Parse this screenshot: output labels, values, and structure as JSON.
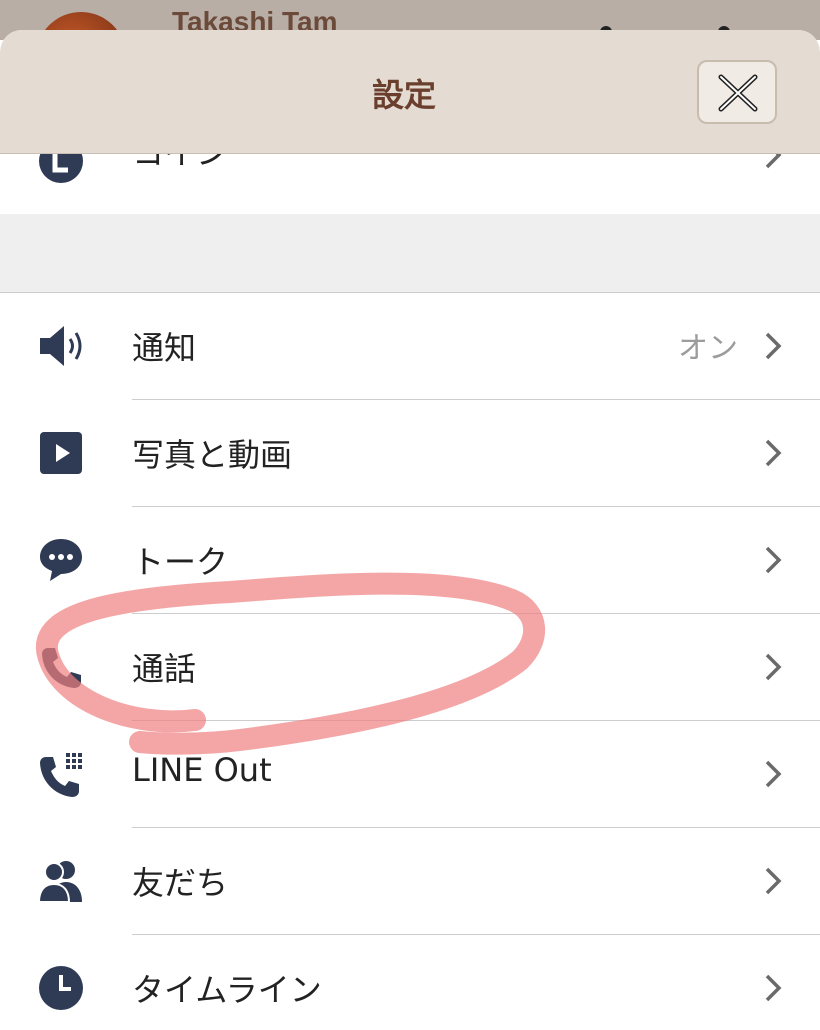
{
  "background": {
    "profile_name": "Takashi Tam"
  },
  "header": {
    "title": "設定",
    "close_icon": "close-icon"
  },
  "rows": [
    {
      "label": "コイン",
      "value": "",
      "icon": "line-coin-icon"
    },
    {
      "label": "通知",
      "value": "オン",
      "icon": "speaker-icon"
    },
    {
      "label": "写真と動画",
      "value": "",
      "icon": "play-icon"
    },
    {
      "label": "トーク",
      "value": "",
      "icon": "chat-bubble-icon"
    },
    {
      "label": "通話",
      "value": "",
      "icon": "phone-icon"
    },
    {
      "label": "LINE Out",
      "value": "",
      "icon": "phone-dialpad-icon"
    },
    {
      "label": "友だち",
      "value": "",
      "icon": "friends-icon"
    },
    {
      "label": "タイムライン",
      "value": "",
      "icon": "clock-icon"
    }
  ],
  "colors": {
    "header_bg": "#e4dcd3",
    "title": "#6a3f2e",
    "icon": "#2f3a55",
    "annotation": "#f08080"
  }
}
